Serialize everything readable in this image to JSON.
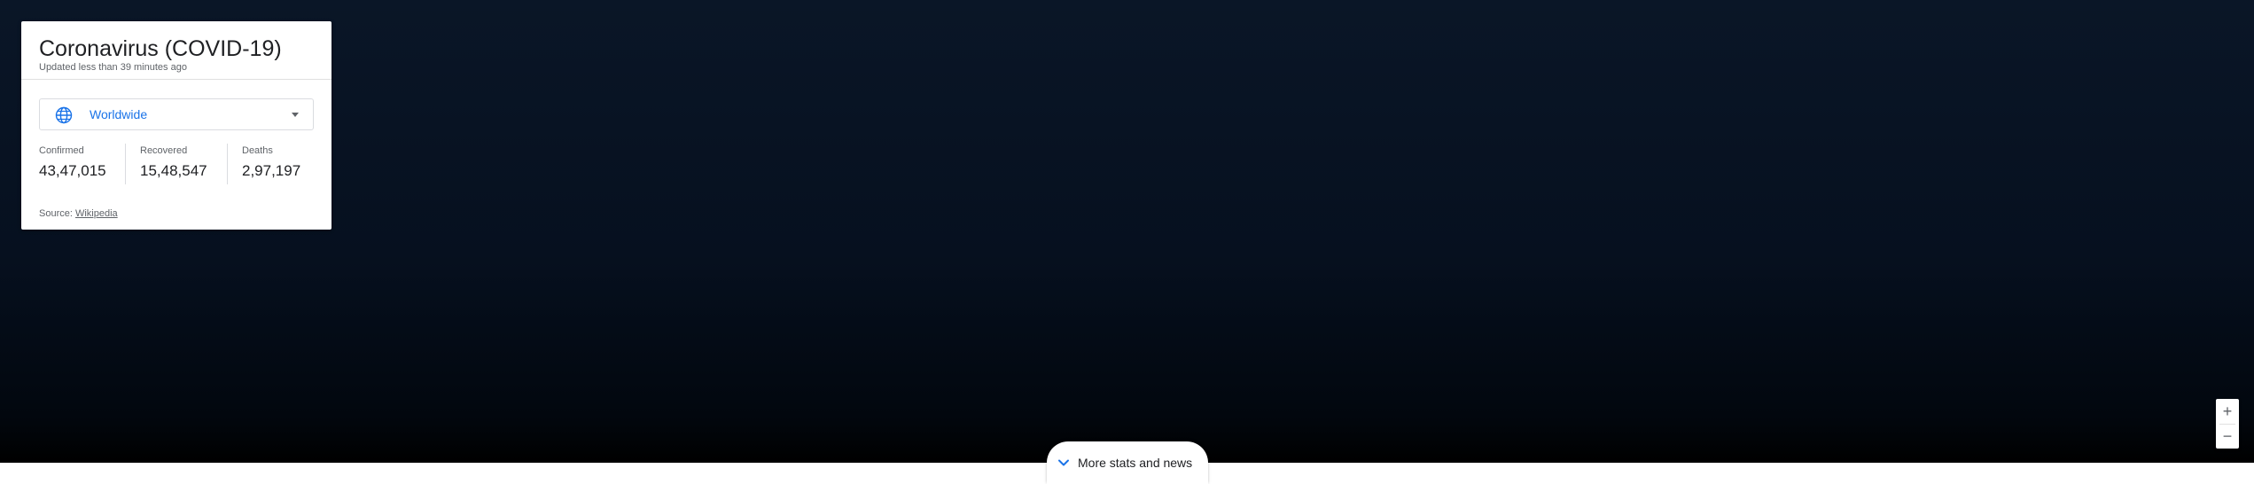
{
  "card": {
    "title": "Coronavirus (COVID-19)",
    "subtitle": "Updated less than 39 minutes ago",
    "region": {
      "selected": "Worldwide",
      "icon": "globe-icon",
      "caret_icon": "caret-down-icon"
    },
    "stats": [
      {
        "label": "Confirmed",
        "value": "43,47,015"
      },
      {
        "label": "Recovered",
        "value": "15,48,547"
      },
      {
        "label": "Deaths",
        "value": "2,97,197"
      }
    ],
    "source": {
      "prefix": "Source: ",
      "link_text": "Wikipedia"
    }
  },
  "zoom": {
    "in_label": "+",
    "out_label": "−"
  },
  "more_button": {
    "label": "More stats and news",
    "icon": "chevron-down-icon"
  },
  "colors": {
    "accent": "#1a73e8",
    "map_background": "#06101f",
    "text_primary": "#202124",
    "text_secondary": "#5f6368"
  }
}
